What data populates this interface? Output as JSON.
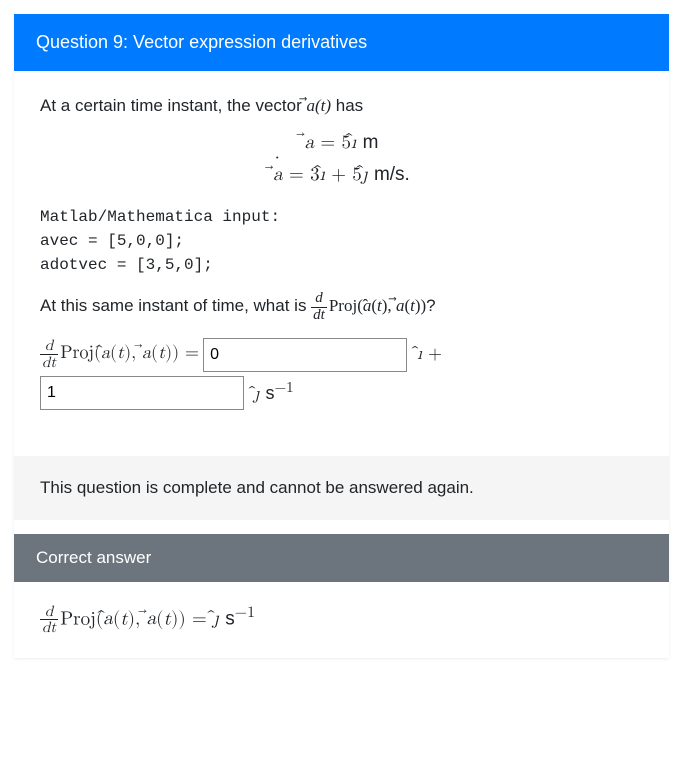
{
  "question": {
    "header": "Question 9: Vector expression derivatives",
    "intro_prefix": "At a certain time instant, the vector ",
    "intro_vec": "a⃗(t)",
    "intro_suffix": " has",
    "eq1_lhs": "a⃗",
    "eq1_rhs_val": "5",
    "eq1_rhs_unitvec": "ı̂",
    "eq1_units": "m",
    "eq2_lhs": "a⃗̇",
    "eq2_rhs_a": "3",
    "eq2_rhs_av": "ı̂",
    "eq2_rhs_plus": " + ",
    "eq2_rhs_b": "5",
    "eq2_rhs_bv": "ȷ̂",
    "eq2_units": "m/s.",
    "code_label": "Matlab/Mathematica input:",
    "code_line1": "avec = [5,0,0];",
    "code_line2": "adotvec = [3,5,0];",
    "prompt2_prefix": "At this same instant of time, what is ",
    "proj_tex": "Proj(â(t), a⃗(t))",
    "prompt2_suffix": "?",
    "input_i_value": "0",
    "ihat_label": "ı̂ +",
    "input_j_value": "1",
    "jhat_label": "ȷ̂",
    "result_units": "s⁻¹"
  },
  "locked_msg": "This question is complete and cannot be answered again.",
  "correct": {
    "header": "Correct answer",
    "expr_lhs": "Proj(â(t), a⃗(t))",
    "expr_eq": " = ",
    "expr_rhs_vec": "ȷ̂",
    "expr_rhs_units": "s⁻¹"
  },
  "math": {
    "ddt_num": "d",
    "ddt_den": "dt"
  }
}
